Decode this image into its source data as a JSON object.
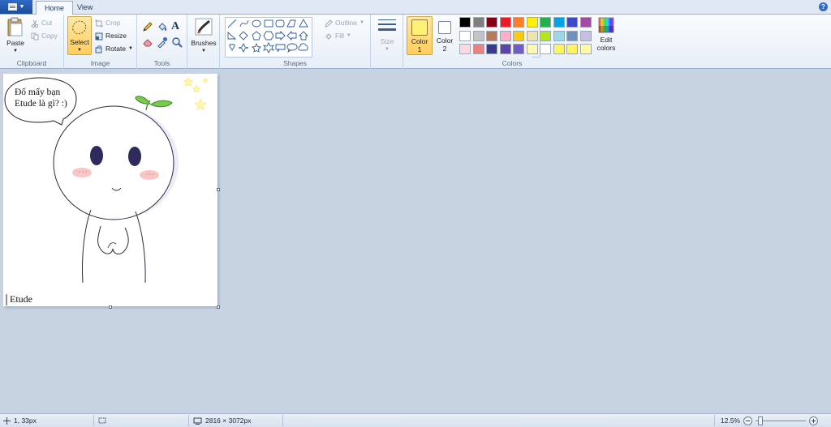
{
  "tabs": {
    "home": "Home",
    "view": "View"
  },
  "help_icon": "?",
  "clipboard": {
    "paste": "Paste",
    "cut": "Cut",
    "copy": "Copy",
    "label": "Clipboard"
  },
  "image": {
    "select": "Select",
    "crop": "Crop",
    "resize": "Resize",
    "rotate": "Rotate",
    "label": "Image"
  },
  "tools": {
    "text_tool": "A",
    "label": "Tools"
  },
  "brushes": {
    "label": "Brushes"
  },
  "shapes": {
    "outline": "Outline",
    "fill": "Fill",
    "label": "Shapes"
  },
  "size": {
    "label": "Size"
  },
  "colors": {
    "color1_label": "Color",
    "color1_num": "1",
    "color2_label": "Color",
    "color2_num": "2",
    "edit_label": "Edit",
    "edit_label2": "colors",
    "label": "Colors",
    "color1_value": "#fff176",
    "color2_value": "#ffffff",
    "palette": [
      "#000000",
      "#7f7f7f",
      "#880015",
      "#ed1c24",
      "#ff7f27",
      "#fff200",
      "#22b14c",
      "#00a2e8",
      "#3f48cc",
      "#a349a4",
      "#ffffff",
      "#c3c3c3",
      "#b97a57",
      "#ffaec9",
      "#ffc90e",
      "#efe4b0",
      "#b5e61d",
      "#99d9ea",
      "#7092be",
      "#c8bfe7",
      "#fadadd",
      "#f08080",
      "#3a3a8c",
      "#5c44a8",
      "#6f5cc4",
      "#fff7b0",
      "#ffffff",
      "#fff45a",
      "#fff45a",
      "#fffaa0"
    ]
  },
  "canvas_content": {
    "bubble_line1": "Đố mấy bạn",
    "bubble_line2": "Etude là gì? :)",
    "signature": "Etude"
  },
  "status": {
    "cursor_pos": "1, 33px",
    "selection_size": "",
    "image_size": "2816 × 3072px",
    "zoom": "12.5%"
  }
}
